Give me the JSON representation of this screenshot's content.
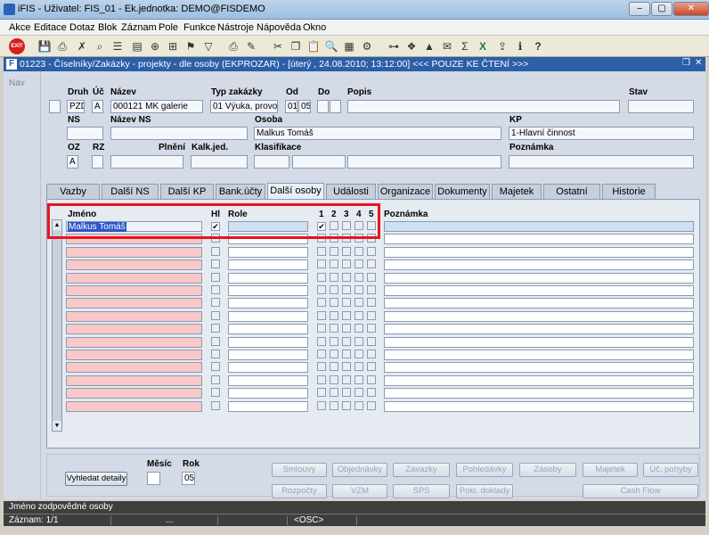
{
  "window": {
    "title": "iFIS - Uživatel: FIS_01 - Ek.jednotka: DEMO@FISDEMO",
    "min_glyph": "‒",
    "max_glyph": "▢",
    "close_glyph": "✕"
  },
  "menu": [
    "Akce",
    "Editace",
    "Dotaz",
    "Blok",
    "Záznam",
    "Pole",
    "Funkce",
    "Nástroje",
    "Nápověda",
    "Okno"
  ],
  "toolbar": {
    "exit_label": "EXIT",
    "icons": [
      "save-icon",
      "print-icon",
      "delete-icon",
      "search-icon",
      "filter-icon",
      "printer-icon",
      "report-icon",
      "cut-icon",
      "copy-icon",
      "paste-icon",
      "search-doc-icon",
      "calc-icon",
      "settings-icon",
      "chart-icon",
      "email-icon",
      "sum-icon",
      "excel-icon",
      "export-icon",
      "info-icon",
      "help-icon"
    ]
  },
  "form": {
    "title": "01223 - Číselníky/Zakázky - projekty - dle osoby (EKPROZAR) - [úterý , 24.08.2010; 13:12:00] <<< POUZE KE ČTENÍ >>>",
    "title_icon": "F",
    "nav_label": "Nav"
  },
  "header": {
    "labels": {
      "druh": "Druh",
      "uc": "Úč",
      "nazev": "Název",
      "typ_zakazky": "Typ zakázky",
      "od": "Od",
      "do": "Do",
      "popis": "Popis",
      "stav": "Stav",
      "ns": "NS",
      "nazev_ns": "Název NS",
      "osoba": "Osoba",
      "kp": "KP",
      "oz": "OZ",
      "rz": "RZ",
      "plneni": "Plnění",
      "kalk_jed": "Kalk.jed.",
      "klasifikace": "Klasifikace",
      "poznamka": "Poznámka"
    },
    "values": {
      "druh": "PZD",
      "uc": "A",
      "nazev": "000121 MK galerie",
      "typ_zakazky": "01 Výuka, provoz (",
      "od1": "01",
      "od2": "05",
      "osoba": "Malkus Tomáš",
      "kp": "1-Hlavní činnost",
      "oz": "A"
    }
  },
  "tabs": [
    "Vazby",
    "Další NS",
    "Další KP",
    "Bank.účty",
    "Další osoby",
    "Události",
    "Organizace",
    "Dokumenty",
    "Majetek",
    "Ostatní",
    "Historie"
  ],
  "active_tab": "Další osoby",
  "grid": {
    "headers": {
      "jmeno": "Jméno",
      "hl": "Hl",
      "role": "Role",
      "c1": "1",
      "c2": "2",
      "c3": "3",
      "c4": "4",
      "c5": "5",
      "poznamka": "Poznámka"
    },
    "first_row_name": "Malkus Tomáš",
    "check_glyph": "✔",
    "scroll_up_glyph": "▲",
    "scroll_down_glyph": "▼"
  },
  "bottom": {
    "vyhledat_label": "Vyhledat detaily",
    "mesic_label": "Měsíc",
    "rok_label": "Rok",
    "rok_value": "05",
    "buttons_row1": [
      "Smlouvy",
      "Objednávky",
      "Závazky",
      "Pohledávky",
      "Zásoby",
      "Majetek",
      "Úč. pohyby"
    ],
    "buttons_row2": [
      "Rozpočty",
      "VZM",
      "SPS",
      "Pokl. doklady",
      "Cash Flow"
    ]
  },
  "status": {
    "hint": "Jméno zodpovědné osoby",
    "record": "Záznam: 1/1",
    "dots": "...",
    "osc": "<OSC>"
  }
}
